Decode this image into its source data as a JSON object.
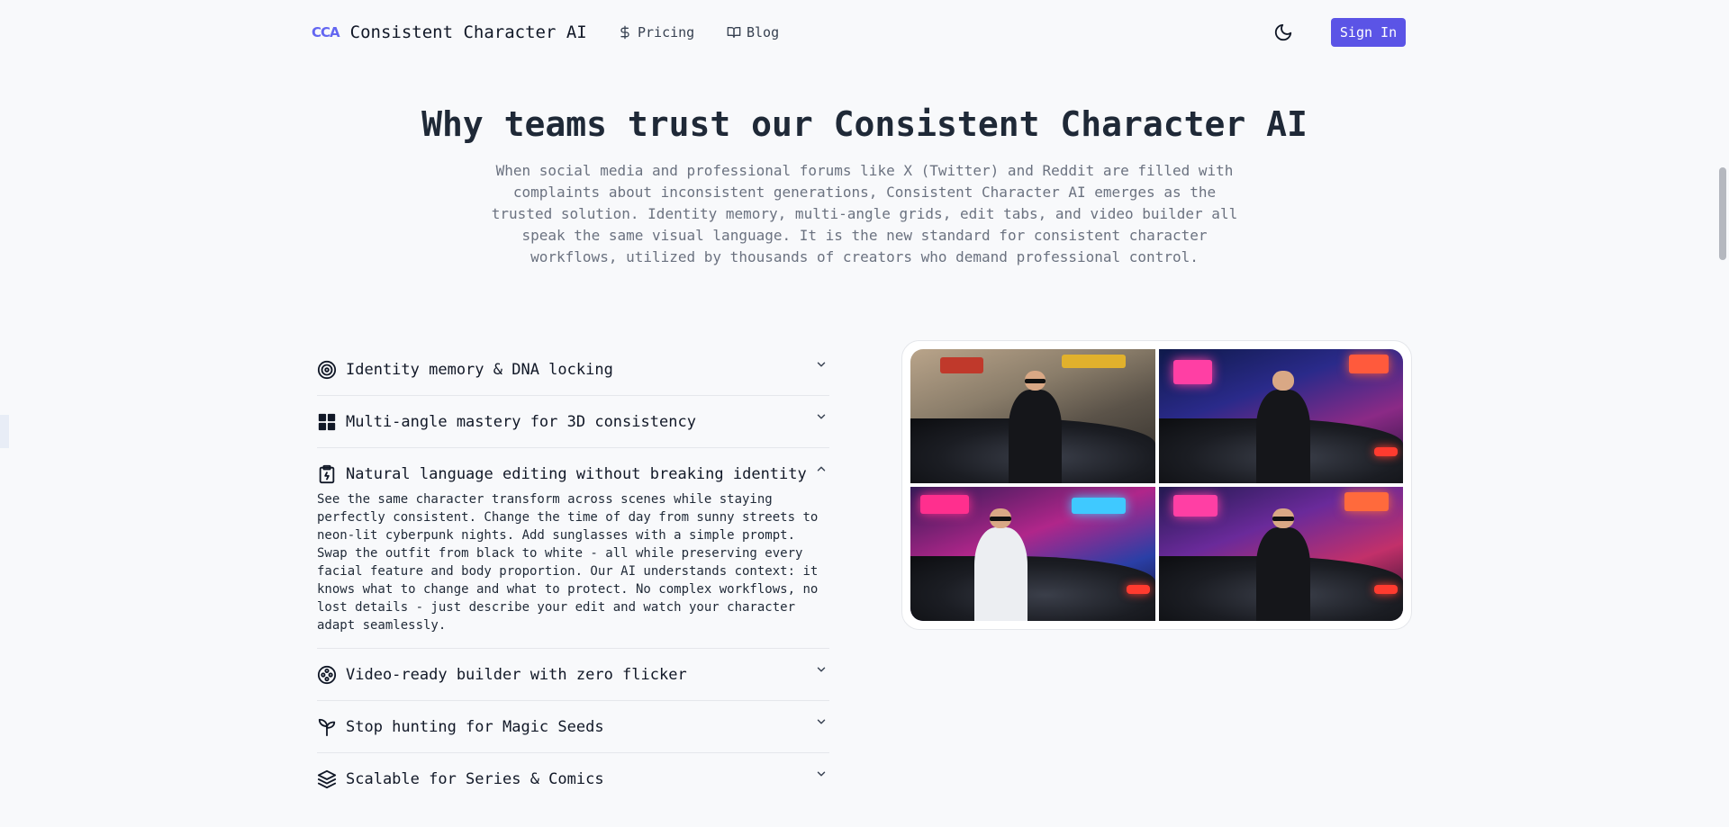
{
  "nav": {
    "logo": "CCA",
    "brand": "Consistent Character AI",
    "links": [
      {
        "label": "Pricing",
        "icon": "dollar-icon"
      },
      {
        "label": "Blog",
        "icon": "book-icon"
      }
    ],
    "theme_icon": "moon-icon",
    "signin_label": "Sign In"
  },
  "hero": {
    "title": "Why teams trust our Consistent Character AI",
    "description": "When social media and professional forums like X (Twitter) and Reddit are filled with complaints about inconsistent generations, Consistent Character AI emerges as the trusted solution. Identity memory, multi-angle grids, edit tabs, and video builder all speak the same visual language. It is the new standard for consistent character workflows, utilized by thousands of creators who demand professional control."
  },
  "features": [
    {
      "title": "Identity memory & DNA locking",
      "icon": "target-icon",
      "expanded": false
    },
    {
      "title": "Multi-angle mastery for 3D consistency",
      "icon": "grid-icon",
      "expanded": false
    },
    {
      "title": "Natural language editing without breaking identity",
      "icon": "clipboard-icon",
      "expanded": true,
      "body": "See the same character transform across scenes while staying perfectly consistent. Change the time of day from sunny streets to neon-lit cyberpunk nights. Add sunglasses with a simple prompt. Swap the outfit from black to white - all while preserving every facial feature and body proportion. Our AI understands context: it knows what to change and what to protect. No complex workflows, no lost details - just describe your edit and watch your character adapt seamlessly."
    },
    {
      "title": "Video-ready builder with zero flicker",
      "icon": "film-reel-icon",
      "expanded": false
    },
    {
      "title": "Stop hunting for Magic Seeds",
      "icon": "sprout-icon",
      "expanded": false
    },
    {
      "title": "Scalable for Series & Comics",
      "icon": "layers-icon",
      "expanded": false
    }
  ],
  "gallery": {
    "images": [
      "character-day-street-image",
      "character-neon-night-image",
      "character-white-suit-image",
      "character-sunglasses-neon-image"
    ]
  },
  "colors": {
    "accent": "#5b54e6",
    "logo": "#6366f1",
    "background": "#f8f9fb"
  }
}
